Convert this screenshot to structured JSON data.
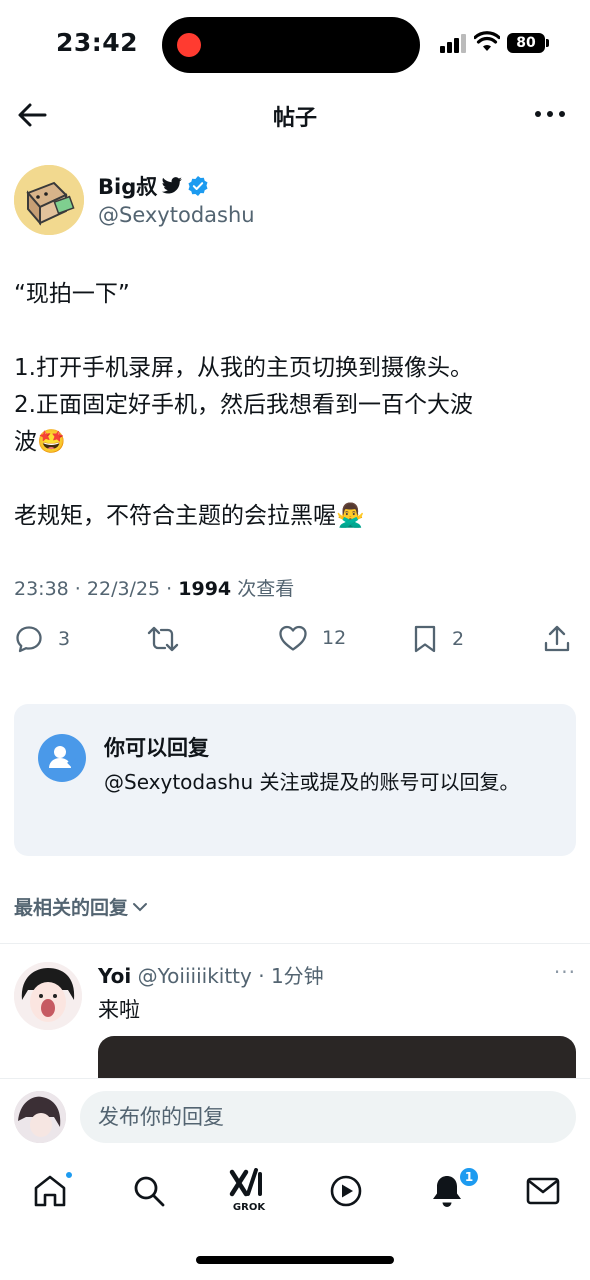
{
  "status_bar": {
    "time": "23:42",
    "battery": "80"
  },
  "header": {
    "title": "帖子"
  },
  "tweet": {
    "author_name": "Big叔",
    "author_handle": "@Sexytodashu",
    "lines": [
      "“现拍一下”",
      "",
      "1.打开手机录屏，从我的主页切换到摄像头。",
      "2.正面固定好手机，然后我想看到一百个大波",
      "波🤩",
      "",
      "老规矩，不符合主题的会拉黑喔🙅‍♂️"
    ],
    "time": "23:38",
    "date": "22/3/25",
    "views": "1994",
    "views_label": "次查看",
    "replies": "3",
    "likes": "12",
    "bookmarks": "2"
  },
  "reply_restriction": {
    "title": "你可以回复",
    "text": "@Sexytodashu 关注或提及的账号可以回复。"
  },
  "sort": {
    "label": "最相关的回复"
  },
  "reply": {
    "name": "Yoi",
    "handle": "@Yoiiiiikitty",
    "time": "1分钟",
    "text": "来啦"
  },
  "compose": {
    "placeholder": "发布你的回复"
  },
  "bottom_nav": {
    "grok_label": "GROK",
    "notification_count": "1"
  },
  "colors": {
    "accent": "#1d9bf0",
    "muted_text": "#536471",
    "card_bg": "#eff3f8",
    "record_dot": "#ff3b30"
  }
}
